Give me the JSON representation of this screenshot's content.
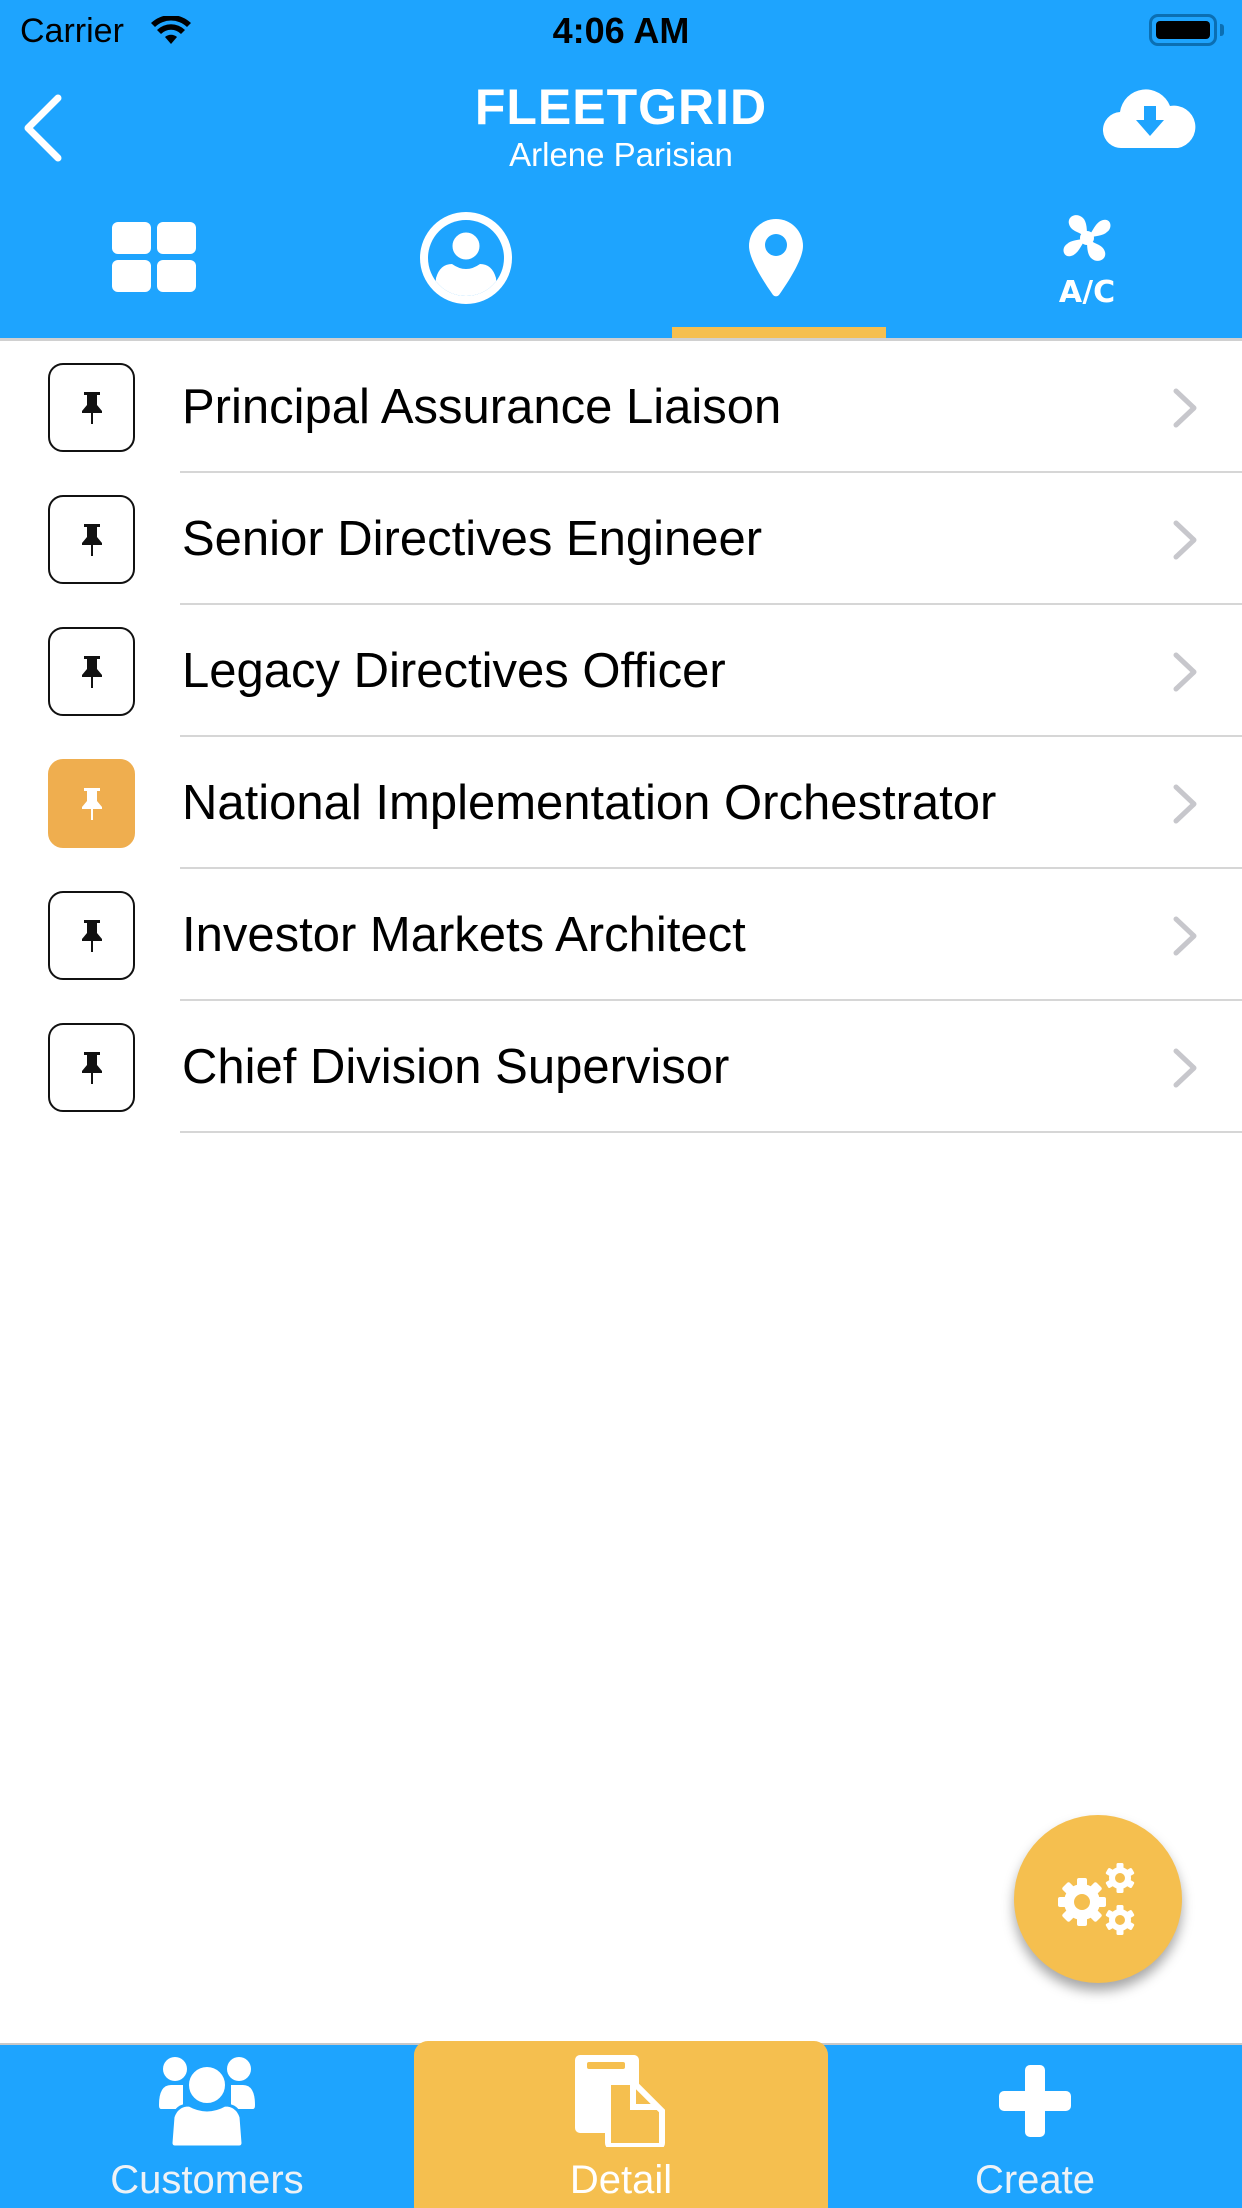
{
  "status_bar": {
    "carrier": "Carrier",
    "time": "4:06 AM",
    "wifi_icon": "wifi-icon",
    "battery_icon": "battery-full-icon"
  },
  "header": {
    "title": "FLEETGRID",
    "subtitle": "Arlene Parisian",
    "back_icon": "chevron-left-icon",
    "download_icon": "cloud-download-icon",
    "background_color": "#1EA4FE"
  },
  "top_tabs": {
    "active_index": 2,
    "items": [
      {
        "name": "dashboard",
        "icon": "grid-icon"
      },
      {
        "name": "profile",
        "icon": "user-circle-icon"
      },
      {
        "name": "locations",
        "icon": "map-pin-icon"
      },
      {
        "name": "air-conditioning",
        "icon": "ac-fan-icon",
        "icon_text": "A/C"
      }
    ],
    "indicator_color": "#F5BF4F"
  },
  "list": {
    "items": [
      {
        "label": "Principal Assurance Liaison",
        "icon": "pushpin-icon",
        "active": false
      },
      {
        "label": "Senior Directives Engineer",
        "icon": "pushpin-icon",
        "active": false
      },
      {
        "label": "Legacy Directives Officer",
        "icon": "pushpin-icon",
        "active": false
      },
      {
        "label": "National Implementation Orchestrator",
        "icon": "pushpin-icon",
        "active": true
      },
      {
        "label": "Investor Markets Architect",
        "icon": "pushpin-icon",
        "active": false
      },
      {
        "label": "Chief Division Supervisor",
        "icon": "pushpin-icon",
        "active": false
      }
    ],
    "active_color": "#EFAE4F",
    "chevron_icon": "chevron-right-icon"
  },
  "fab": {
    "icon": "gears-icon",
    "color": "#F5BF4F"
  },
  "bottom_tabs": {
    "active_index": 1,
    "items": [
      {
        "label": "Customers",
        "icon": "users-group-icon"
      },
      {
        "label": "Detail",
        "icon": "documents-icon"
      },
      {
        "label": "Create",
        "icon": "plus-icon"
      }
    ],
    "active_color": "#F5BF4F"
  }
}
